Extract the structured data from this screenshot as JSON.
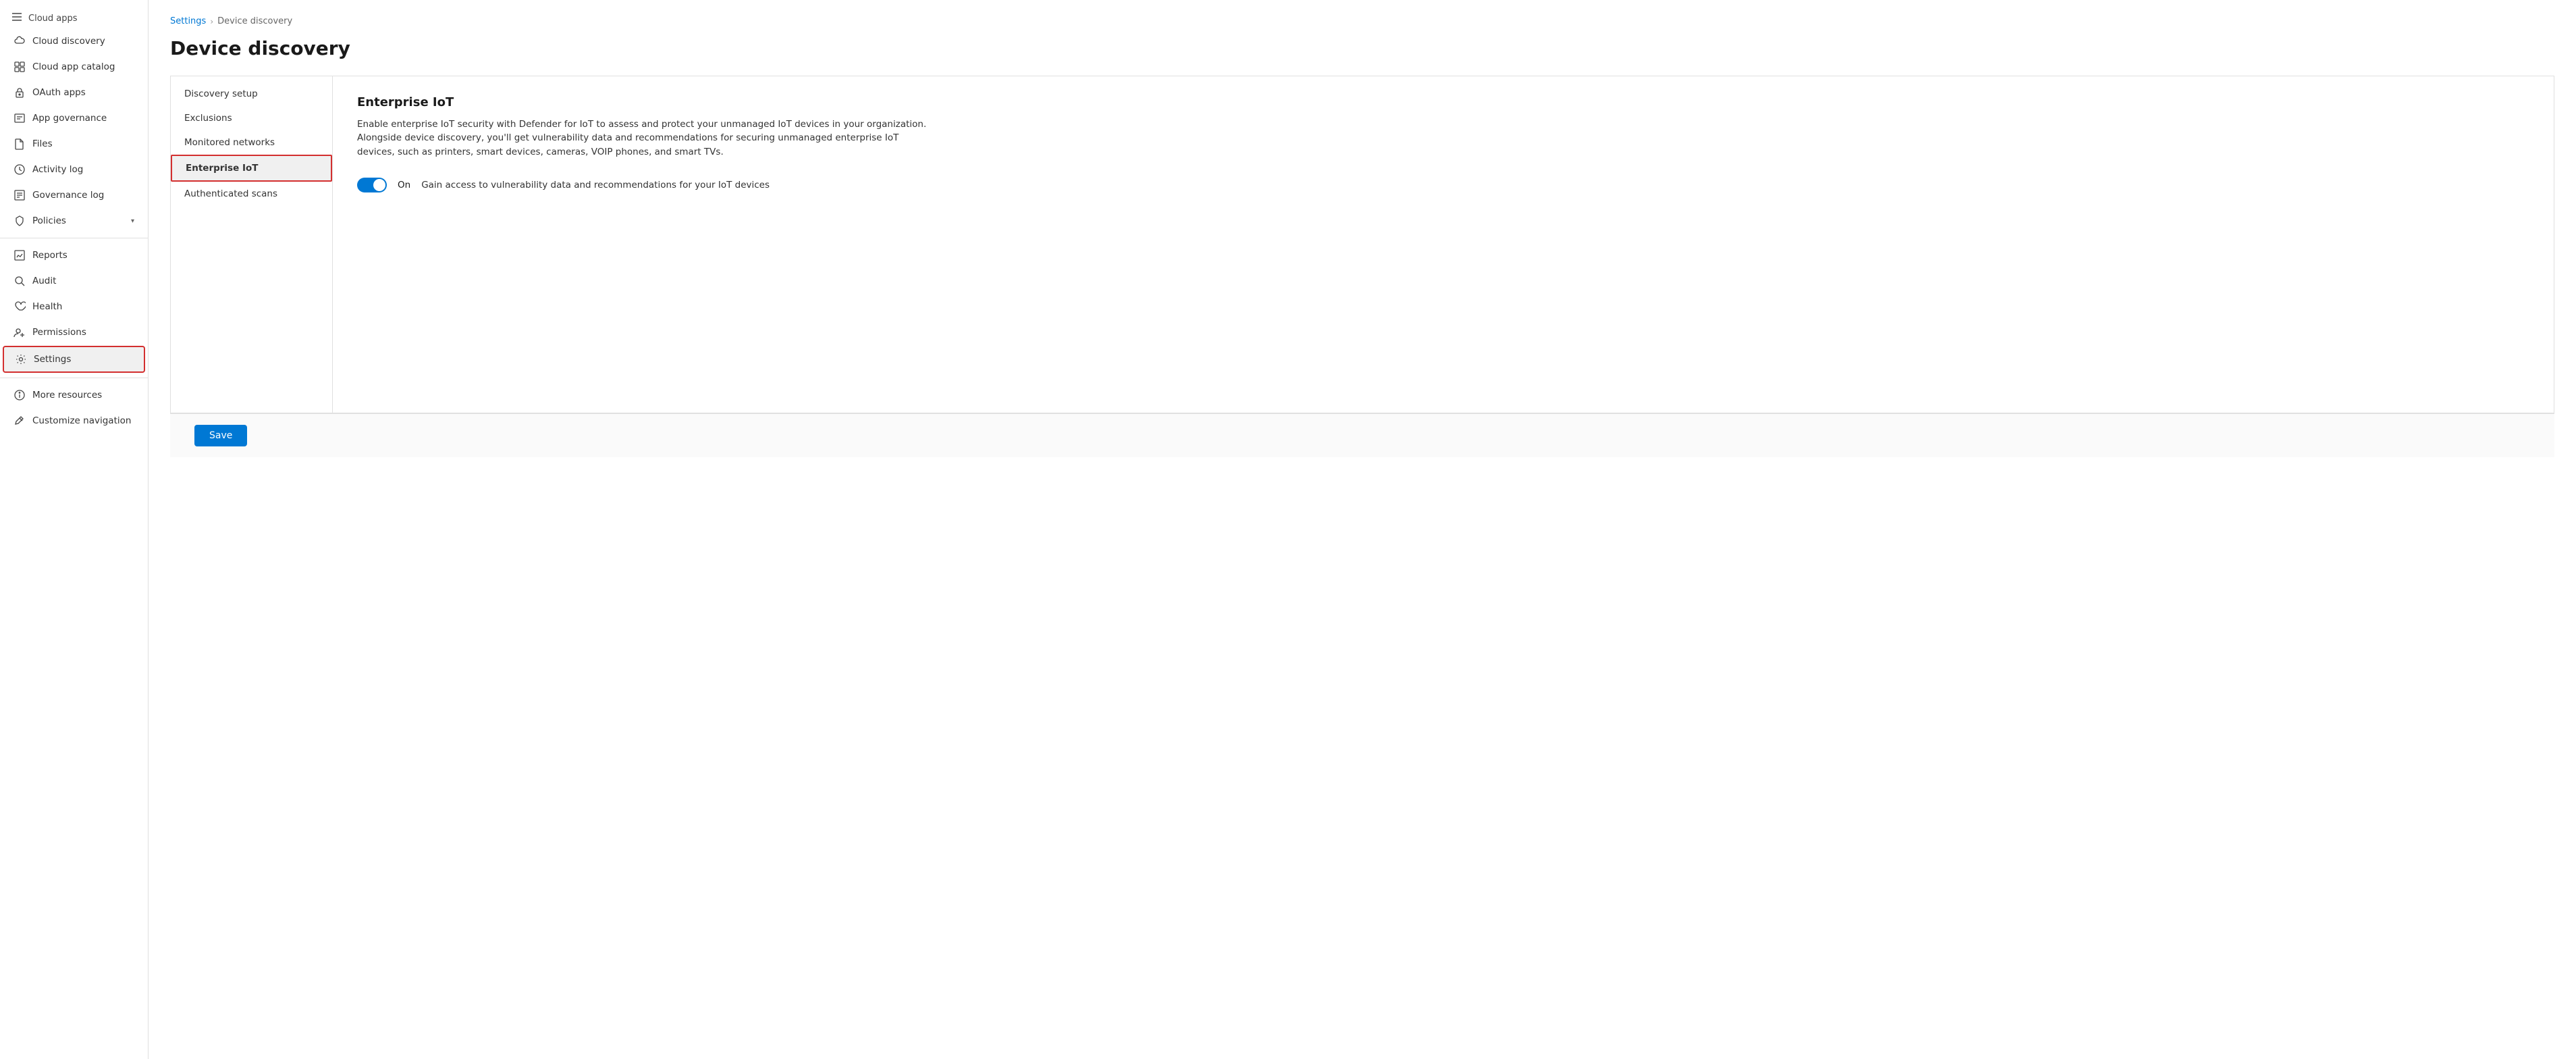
{
  "sidebar": {
    "top_item": "Cloud apps",
    "items": [
      {
        "id": "cloud-discovery",
        "label": "Cloud discovery",
        "icon": "cloud-icon"
      },
      {
        "id": "cloud-app-catalog",
        "label": "Cloud app catalog",
        "icon": "grid-icon"
      },
      {
        "id": "oauth-apps",
        "label": "OAuth apps",
        "icon": "key-icon"
      },
      {
        "id": "app-governance",
        "label": "App governance",
        "icon": "governance-icon"
      },
      {
        "id": "files",
        "label": "Files",
        "icon": "file-icon"
      },
      {
        "id": "activity-log",
        "label": "Activity log",
        "icon": "log-icon"
      },
      {
        "id": "governance-log",
        "label": "Governance log",
        "icon": "govlog-icon"
      },
      {
        "id": "policies",
        "label": "Policies",
        "icon": "policy-icon",
        "hasChevron": true
      },
      {
        "id": "reports",
        "label": "Reports",
        "icon": "reports-icon"
      },
      {
        "id": "audit",
        "label": "Audit",
        "icon": "audit-icon"
      },
      {
        "id": "health",
        "label": "Health",
        "icon": "health-icon"
      },
      {
        "id": "permissions",
        "label": "Permissions",
        "icon": "permissions-icon"
      },
      {
        "id": "settings",
        "label": "Settings",
        "icon": "settings-icon",
        "active": true
      },
      {
        "id": "more-resources",
        "label": "More resources",
        "icon": "more-icon"
      },
      {
        "id": "customize-navigation",
        "label": "Customize navigation",
        "icon": "customize-icon"
      }
    ]
  },
  "breadcrumb": {
    "items": [
      {
        "label": "Settings",
        "link": true
      },
      {
        "label": "Device discovery",
        "link": false
      }
    ]
  },
  "page": {
    "title": "Device discovery"
  },
  "sub_nav": {
    "items": [
      {
        "id": "discovery-setup",
        "label": "Discovery setup",
        "active": false
      },
      {
        "id": "exclusions",
        "label": "Exclusions",
        "active": false
      },
      {
        "id": "monitored-networks",
        "label": "Monitored networks",
        "active": false
      },
      {
        "id": "enterprise-iot",
        "label": "Enterprise IoT",
        "active": true
      },
      {
        "id": "authenticated-scans",
        "label": "Authenticated scans",
        "active": false
      }
    ]
  },
  "enterprise_iot": {
    "title": "Enterprise IoT",
    "description": "Enable enterprise IoT security with Defender for IoT to assess and protect your unmanaged IoT devices in your organization. Alongside device discovery, you'll get vulnerability data and recommendations for securing unmanaged enterprise IoT devices, such as printers, smart devices, cameras, VOIP phones, and smart TVs.",
    "toggle": {
      "state": "On",
      "enabled": true,
      "description": "Gain access to vulnerability data and recommendations for your IoT devices"
    }
  },
  "footer": {
    "save_label": "Save"
  }
}
